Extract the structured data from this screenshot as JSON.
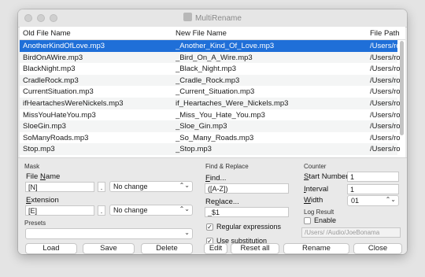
{
  "window": {
    "title": "MultiRename"
  },
  "table": {
    "columns": [
      "Old File Name",
      "New File Name",
      "File Path"
    ],
    "rows": [
      {
        "old": "AnotherKindOfLove.mp3",
        "new": "_Another_Kind_Of_Love.mp3",
        "path": "/Users/ro"
      },
      {
        "old": "BirdOnAWire.mp3",
        "new": "_Bird_On_A_Wire.mp3",
        "path": "/Users/ro"
      },
      {
        "old": "BlackNight.mp3",
        "new": "_Black_Night.mp3",
        "path": "/Users/ro"
      },
      {
        "old": "CradleRock.mp3",
        "new": "_Cradle_Rock.mp3",
        "path": "/Users/ro"
      },
      {
        "old": "CurrentSituation.mp3",
        "new": "_Current_Situation.mp3",
        "path": "/Users/ro"
      },
      {
        "old": "ifHeartachesWereNickels.mp3",
        "new": "if_Heartaches_Were_Nickels.mp3",
        "path": "/Users/ro"
      },
      {
        "old": "MissYouHateYou.mp3",
        "new": "_Miss_You_Hate_You.mp3",
        "path": "/Users/ro"
      },
      {
        "old": "SloeGin.mp3",
        "new": "_Sloe_Gin.mp3",
        "path": "/Users/ro"
      },
      {
        "old": "SoManyRoads.mp3",
        "new": "_So_Many_Roads.mp3",
        "path": "/Users/ro"
      },
      {
        "old": "Stop.mp3",
        "new": "_Stop.mp3",
        "path": "/Users/ro"
      }
    ],
    "selected_index": 0
  },
  "mask": {
    "group_label": "Mask",
    "filename_label": "File Name",
    "filename_value": "[N]",
    "filename_sep": ".",
    "filename_case": "No change",
    "extension_label": "Extension",
    "extension_value": "[E]",
    "extension_sep": ".",
    "extension_case": "No change"
  },
  "presets": {
    "group_label": "Presets",
    "value": "",
    "load_label": "Load",
    "save_label": "Save",
    "delete_label": "Delete"
  },
  "find_replace": {
    "group_label": "Find & Replace",
    "find_label": "Find...",
    "find_value": "([A-Z])",
    "replace_label": "Replace...",
    "replace_value": "_$1",
    "regex_label": "Regular expressions",
    "regex_checked": true,
    "subst_label": "Use substitution",
    "subst_checked": true
  },
  "counter": {
    "group_label": "Counter",
    "start_label": "Start Number",
    "start_value": "1",
    "interval_label": "Interval",
    "interval_value": "1",
    "width_label": "Width",
    "width_value": "01"
  },
  "log": {
    "group_label": "Log Result",
    "enable_label": "Enable",
    "enable_checked": false,
    "path_value": "/Users/     /Audio/JoeBonama"
  },
  "actions": {
    "edit_label": "Edit",
    "reset_label": "Reset all",
    "rename_label": "Rename",
    "close_label": "Close"
  }
}
